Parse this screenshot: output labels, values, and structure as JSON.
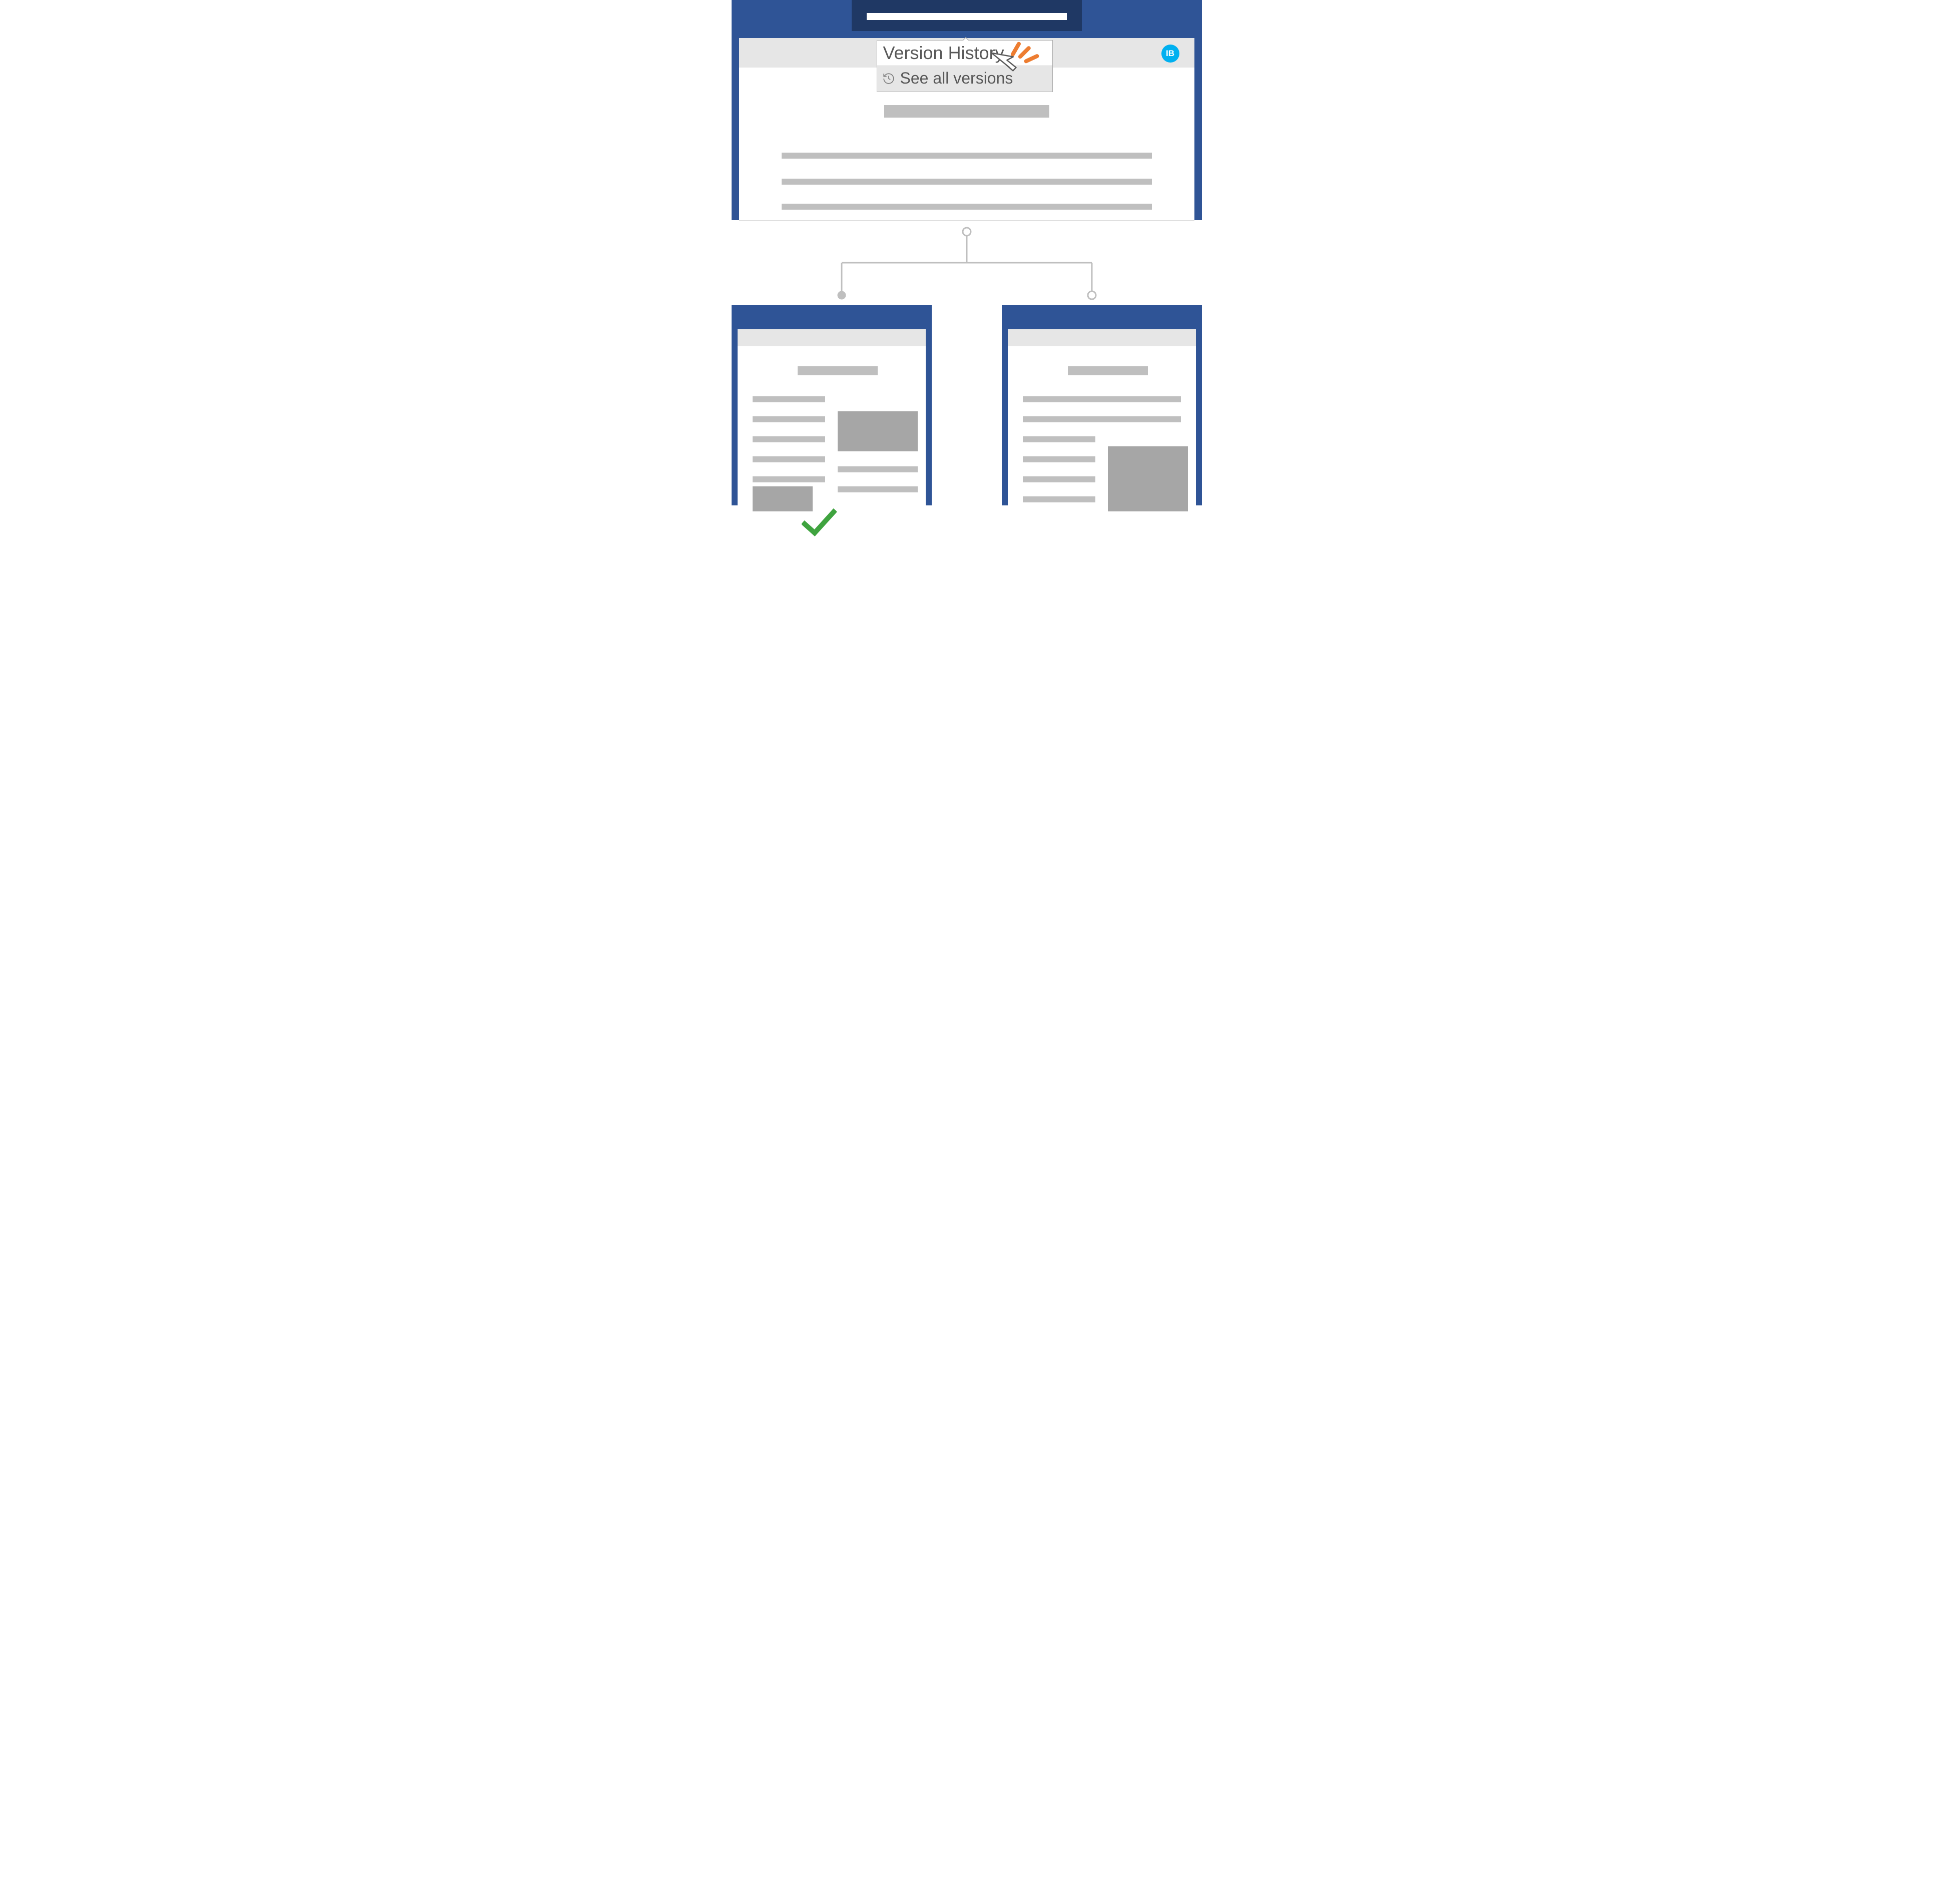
{
  "dropdown": {
    "title": "Version History",
    "item_label": "See all versions"
  },
  "avatar": {
    "initials": "IB"
  },
  "colors": {
    "chrome_dark": "#1f3864",
    "chrome": "#2f5496",
    "ribbon": "#e6e6e6",
    "avatar_bg": "#00b0f0",
    "accent_spark": "#ed7d31",
    "check": "#3fa33f",
    "connector": "#bfbfbf"
  }
}
